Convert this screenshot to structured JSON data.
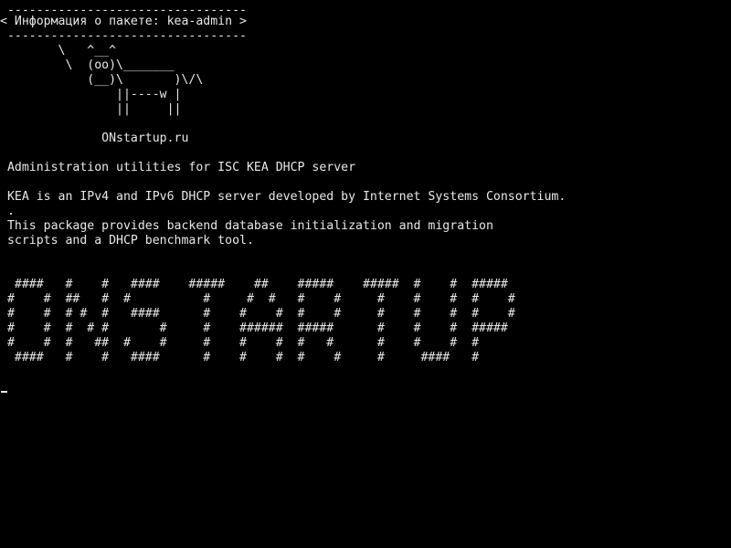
{
  "terminal": {
    "lines": [
      " ---------------------------------",
      "< Информация о пакете: kea-admin >",
      " ---------------------------------",
      "        \\   ^__^",
      "         \\  (oo)\\_______",
      "            (__)\\       )\\/\\",
      "                ||----w |",
      "                ||     ||",
      "",
      "              ONstartup.ru",
      "",
      " Administration utilities for ISC KEA DHCP server",
      "",
      " KEA is an IPv4 and IPv6 DHCP server developed by Internet Systems Consortium.",
      " .",
      " This package provides backend database initialization and migration",
      " scripts and a DHCP benchmark tool.",
      "",
      "",
      "  ####   #    #   ####    #####    ##    #####    #####  #    #  #####",
      " #    #  ##   #  #          #     #  #   #    #     #    #    #  #    #",
      " #    #  # #  #   ####      #    #    #  #    #     #    #    #  #    #",
      " #    #  #  # #       #     #    ######  #####      #    #    #  #####",
      " #    #  #   ##  #    #     #    #    #  #   #      #    #    #  #",
      "  ####   #    #   ####      #    #    #  #    #     #     ####   #"
    ],
    "colors": {
      "background": "#000000",
      "foreground": "#e8e8e8"
    }
  }
}
